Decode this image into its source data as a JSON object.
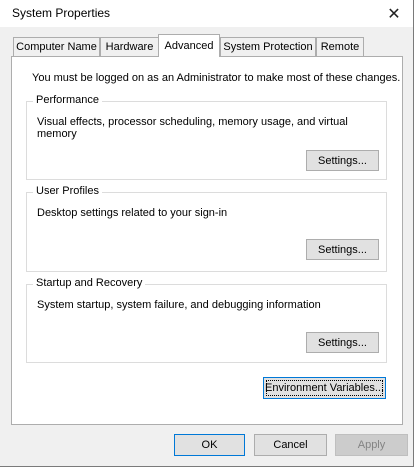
{
  "window": {
    "title": "System Properties"
  },
  "tabs": [
    {
      "label": "Computer Name"
    },
    {
      "label": "Hardware"
    },
    {
      "label": "Advanced"
    },
    {
      "label": "System Protection"
    },
    {
      "label": "Remote"
    }
  ],
  "active_tab": "Advanced",
  "notice": "You must be logged on as an Administrator to make most of these changes.",
  "groups": {
    "performance": {
      "title": "Performance",
      "description": "Visual effects, processor scheduling, memory usage, and virtual memory",
      "button": "Settings..."
    },
    "user_profiles": {
      "title": "User Profiles",
      "description": "Desktop settings related to your sign-in",
      "button": "Settings..."
    },
    "startup_recovery": {
      "title": "Startup and Recovery",
      "description": "System startup, system failure, and debugging information",
      "button": "Settings..."
    }
  },
  "environment_button": "Environment Variables...",
  "footer": {
    "ok": "OK",
    "cancel": "Cancel",
    "apply": "Apply"
  },
  "icons": {
    "close": "close-icon"
  }
}
